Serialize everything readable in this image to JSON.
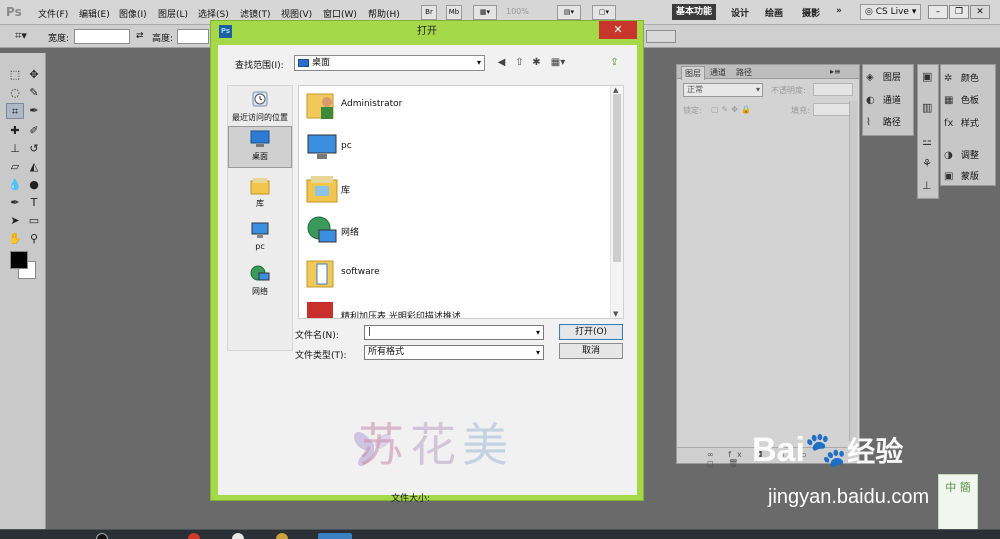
{
  "app": {
    "logo": "Ps",
    "menu": [
      "文件(F)",
      "编辑(E)",
      "图像(I)",
      "图层(L)",
      "选择(S)",
      "滤镜(T)",
      "视图(V)",
      "窗口(W)",
      "帮助(H)"
    ],
    "bridge_btn": "Br",
    "mini_btn": "Mb",
    "zoom": "100%",
    "workspaces": [
      "基本功能",
      "设计",
      "绘画",
      "摄影"
    ],
    "more": "»",
    "cslive": "CS Live"
  },
  "options": {
    "width_label": "宽度:",
    "height_label": "高度:",
    "swap": "⇄"
  },
  "layers_panel": {
    "tabs": [
      "图层",
      "通道",
      "路径"
    ],
    "blend_mode": "正常",
    "opacity_label": "不透明度:",
    "lock_label": "锁定:",
    "fill_label": "填充:",
    "bottom_icons": "∞ fx ◘ ◐ ▭ ◻ 🗑"
  },
  "dock": {
    "col1": [
      "图层",
      "通道",
      "路径"
    ],
    "col3": [
      "颜色",
      "色板",
      "样式",
      "调整",
      "蒙版"
    ]
  },
  "dialog": {
    "icon": "Ps",
    "title": "打开",
    "close": "✕",
    "lookin_label": "查找范围(I):",
    "lookin_value": "桌面",
    "places": [
      "最近访问的位置",
      "桌面",
      "库",
      "pc",
      "网络"
    ],
    "files": [
      "Administrator",
      "pc",
      "库",
      "网络",
      "software",
      "精利加压表 光明彩印描述推述"
    ],
    "filename_label": "文件名(N):",
    "filename_value": "",
    "filetype_label": "文件类型(T):",
    "filetype_value": "所有格式",
    "open_btn": "打开(O)",
    "cancel_btn": "取消",
    "filesize_label": "文件大小:",
    "watermark": "苏花美"
  },
  "watermarks": {
    "baidu_text": "Bai",
    "baidu_cn": "经验",
    "baidu_url": "jingyan.baidu.com",
    "corner": "中 簡"
  }
}
